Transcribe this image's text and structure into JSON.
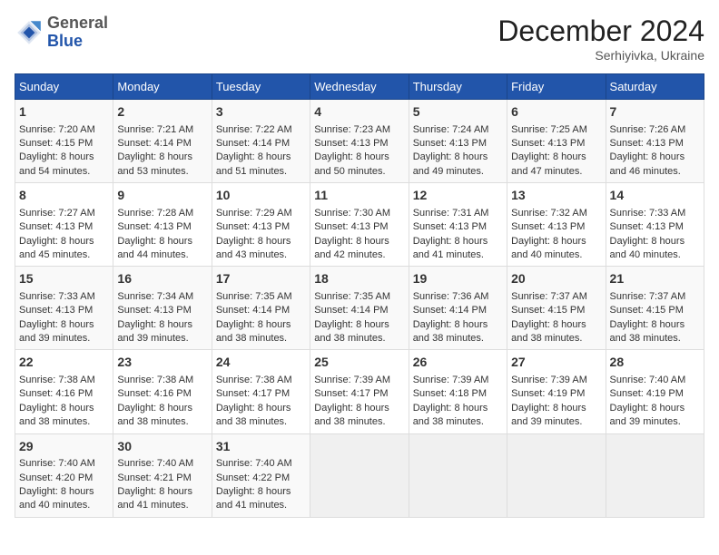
{
  "header": {
    "logo_line1": "General",
    "logo_line2": "Blue",
    "month": "December 2024",
    "location": "Serhiyivka, Ukraine"
  },
  "days_of_week": [
    "Sunday",
    "Monday",
    "Tuesday",
    "Wednesday",
    "Thursday",
    "Friday",
    "Saturday"
  ],
  "weeks": [
    [
      {
        "day": "1",
        "sunrise": "7:20 AM",
        "sunset": "4:15 PM",
        "daylight": "8 hours and 54 minutes."
      },
      {
        "day": "2",
        "sunrise": "7:21 AM",
        "sunset": "4:14 PM",
        "daylight": "8 hours and 53 minutes."
      },
      {
        "day": "3",
        "sunrise": "7:22 AM",
        "sunset": "4:14 PM",
        "daylight": "8 hours and 51 minutes."
      },
      {
        "day": "4",
        "sunrise": "7:23 AM",
        "sunset": "4:13 PM",
        "daylight": "8 hours and 50 minutes."
      },
      {
        "day": "5",
        "sunrise": "7:24 AM",
        "sunset": "4:13 PM",
        "daylight": "8 hours and 49 minutes."
      },
      {
        "day": "6",
        "sunrise": "7:25 AM",
        "sunset": "4:13 PM",
        "daylight": "8 hours and 47 minutes."
      },
      {
        "day": "7",
        "sunrise": "7:26 AM",
        "sunset": "4:13 PM",
        "daylight": "8 hours and 46 minutes."
      }
    ],
    [
      {
        "day": "8",
        "sunrise": "7:27 AM",
        "sunset": "4:13 PM",
        "daylight": "8 hours and 45 minutes."
      },
      {
        "day": "9",
        "sunrise": "7:28 AM",
        "sunset": "4:13 PM",
        "daylight": "8 hours and 44 minutes."
      },
      {
        "day": "10",
        "sunrise": "7:29 AM",
        "sunset": "4:13 PM",
        "daylight": "8 hours and 43 minutes."
      },
      {
        "day": "11",
        "sunrise": "7:30 AM",
        "sunset": "4:13 PM",
        "daylight": "8 hours and 42 minutes."
      },
      {
        "day": "12",
        "sunrise": "7:31 AM",
        "sunset": "4:13 PM",
        "daylight": "8 hours and 41 minutes."
      },
      {
        "day": "13",
        "sunrise": "7:32 AM",
        "sunset": "4:13 PM",
        "daylight": "8 hours and 40 minutes."
      },
      {
        "day": "14",
        "sunrise": "7:33 AM",
        "sunset": "4:13 PM",
        "daylight": "8 hours and 40 minutes."
      }
    ],
    [
      {
        "day": "15",
        "sunrise": "7:33 AM",
        "sunset": "4:13 PM",
        "daylight": "8 hours and 39 minutes."
      },
      {
        "day": "16",
        "sunrise": "7:34 AM",
        "sunset": "4:13 PM",
        "daylight": "8 hours and 39 minutes."
      },
      {
        "day": "17",
        "sunrise": "7:35 AM",
        "sunset": "4:14 PM",
        "daylight": "8 hours and 38 minutes."
      },
      {
        "day": "18",
        "sunrise": "7:35 AM",
        "sunset": "4:14 PM",
        "daylight": "8 hours and 38 minutes."
      },
      {
        "day": "19",
        "sunrise": "7:36 AM",
        "sunset": "4:14 PM",
        "daylight": "8 hours and 38 minutes."
      },
      {
        "day": "20",
        "sunrise": "7:37 AM",
        "sunset": "4:15 PM",
        "daylight": "8 hours and 38 minutes."
      },
      {
        "day": "21",
        "sunrise": "7:37 AM",
        "sunset": "4:15 PM",
        "daylight": "8 hours and 38 minutes."
      }
    ],
    [
      {
        "day": "22",
        "sunrise": "7:38 AM",
        "sunset": "4:16 PM",
        "daylight": "8 hours and 38 minutes."
      },
      {
        "day": "23",
        "sunrise": "7:38 AM",
        "sunset": "4:16 PM",
        "daylight": "8 hours and 38 minutes."
      },
      {
        "day": "24",
        "sunrise": "7:38 AM",
        "sunset": "4:17 PM",
        "daylight": "8 hours and 38 minutes."
      },
      {
        "day": "25",
        "sunrise": "7:39 AM",
        "sunset": "4:17 PM",
        "daylight": "8 hours and 38 minutes."
      },
      {
        "day": "26",
        "sunrise": "7:39 AM",
        "sunset": "4:18 PM",
        "daylight": "8 hours and 38 minutes."
      },
      {
        "day": "27",
        "sunrise": "7:39 AM",
        "sunset": "4:19 PM",
        "daylight": "8 hours and 39 minutes."
      },
      {
        "day": "28",
        "sunrise": "7:40 AM",
        "sunset": "4:19 PM",
        "daylight": "8 hours and 39 minutes."
      }
    ],
    [
      {
        "day": "29",
        "sunrise": "7:40 AM",
        "sunset": "4:20 PM",
        "daylight": "8 hours and 40 minutes."
      },
      {
        "day": "30",
        "sunrise": "7:40 AM",
        "sunset": "4:21 PM",
        "daylight": "8 hours and 41 minutes."
      },
      {
        "day": "31",
        "sunrise": "7:40 AM",
        "sunset": "4:22 PM",
        "daylight": "8 hours and 41 minutes."
      },
      null,
      null,
      null,
      null
    ]
  ],
  "labels": {
    "sunrise": "Sunrise:",
    "sunset": "Sunset:",
    "daylight": "Daylight:"
  }
}
